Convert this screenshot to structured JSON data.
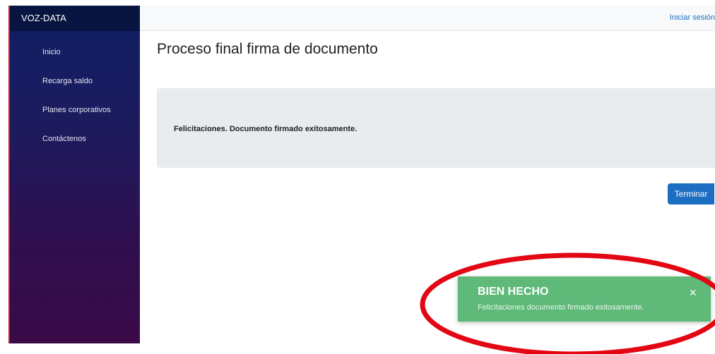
{
  "sidebar": {
    "brand": "VOZ-DATA",
    "items": [
      {
        "label": "Inicio"
      },
      {
        "label": "Recarga saldo"
      },
      {
        "label": "Planes corporativos"
      },
      {
        "label": "Contáctenos"
      }
    ]
  },
  "header": {
    "login_label": "Iniciar sesión"
  },
  "main": {
    "title": "Proceso final firma de documento",
    "alert_text": "Felicitaciones. Documento firmado exitosamente.",
    "finish_label": "Terminar"
  },
  "toast": {
    "title": "BIEN HECHO",
    "message": "Felicitaciones documento firmado exitosamente.",
    "close_glyph": "×"
  },
  "colors": {
    "sidebar_top": "#0f1f63",
    "sidebar_bottom": "#3a0a47",
    "accent_blue": "#1b6ec2",
    "toast_green": "#5fb978",
    "annotation_red": "#e30613"
  }
}
